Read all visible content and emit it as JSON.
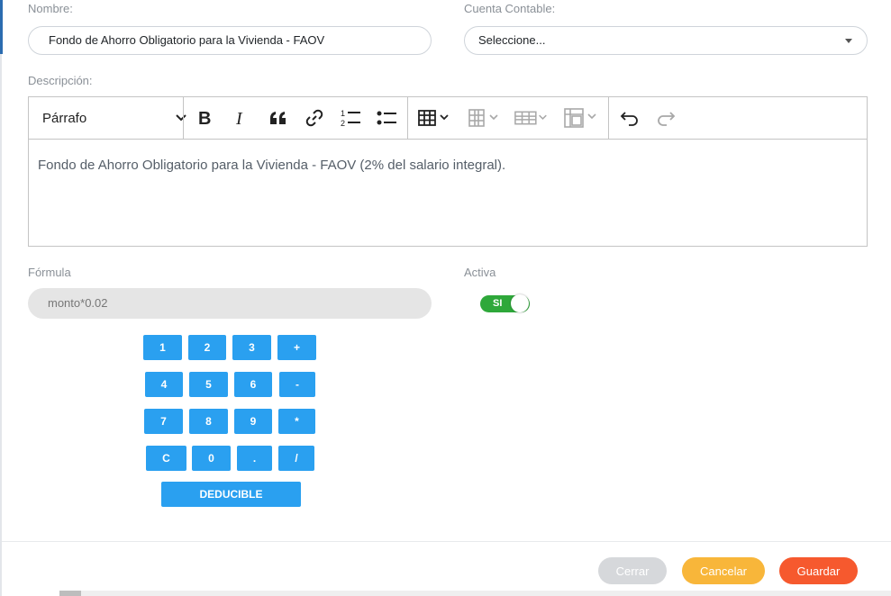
{
  "form": {
    "nombre_label": "Nombre:",
    "nombre_value": "Fondo de Ahorro Obligatorio para la Vivienda - FAOV",
    "cuenta_label": "Cuenta Contable:",
    "cuenta_value": "Seleccione...",
    "descripcion_label": "Descripción:",
    "formula_label": "Fórmula",
    "formula_value": "monto*0.02",
    "activa_label": "Activa",
    "activa_toggle_label": "SI",
    "activa_on": true
  },
  "editor": {
    "heading_select": "Párrafo",
    "content": "Fondo de Ahorro Obligatorio para la Vivienda - FAOV (2% del salario integral).",
    "toolbar_icons": [
      "chevron-down-icon",
      "bold-icon",
      "italic-icon",
      "blockquote-icon",
      "link-icon",
      "numbered-list-icon",
      "bulleted-list-icon",
      "table-icon",
      "table-column-icon",
      "table-row-icon",
      "merge-cells-icon",
      "undo-icon",
      "redo-icon"
    ]
  },
  "keypad": {
    "rows": [
      [
        "1",
        "2",
        "3",
        "+"
      ],
      [
        "4",
        "5",
        "6",
        "-"
      ],
      [
        "7",
        "8",
        "9",
        "*"
      ],
      [
        "C",
        "0",
        ".",
        "/"
      ]
    ],
    "deducible": "DEDUCIBLE"
  },
  "buttons": {
    "cerrar": "Cerrar",
    "cancelar": "Cancelar",
    "guardar": "Guardar"
  },
  "colors": {
    "keypad": "#2aa0f0",
    "toggle_on": "#2ea83a",
    "cerrar": "#d6d8db",
    "cancelar": "#f8b63a",
    "guardar": "#f6592e"
  }
}
